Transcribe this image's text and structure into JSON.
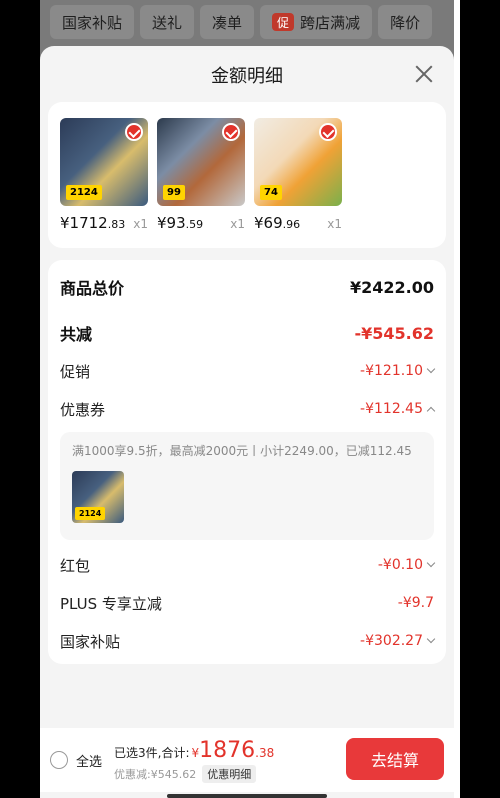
{
  "top_tabs": [
    {
      "label": "国家补贴"
    },
    {
      "label": "送礼"
    },
    {
      "label": "凑单"
    },
    {
      "label": "跨店满减",
      "icon": "promo-icon",
      "icon_text": "促"
    },
    {
      "label": "降价"
    }
  ],
  "sheet": {
    "title": "金额明细"
  },
  "products": [
    {
      "price_int": "¥1712",
      "price_dec": ".83",
      "qty": "x1",
      "tag": "2124"
    },
    {
      "price_int": "¥93",
      "price_dec": ".59",
      "qty": "x1",
      "tag": "99"
    },
    {
      "price_int": "¥69",
      "price_dec": ".96",
      "qty": "x1",
      "tag": "74"
    }
  ],
  "details": {
    "total_label": "商品总价",
    "total_value": "¥2422.00",
    "reduce_label": "共减",
    "reduce_value": "-¥545.62",
    "promo_label": "促销",
    "promo_value": "-¥121.10",
    "coupon_label": "优惠券",
    "coupon_value": "-¥112.45",
    "coupon_text": "满1000享9.5折，最高减2000元丨小计2249.00，已减112.45",
    "coupon_thumb_tag": "2124",
    "redpacket_label": "红包",
    "redpacket_value": "-¥0.10",
    "plus_label": "PLUS 专享立减",
    "plus_value": "-¥9.7",
    "subsidy_label": "国家补贴",
    "subsidy_value": "-¥302.27"
  },
  "bottom": {
    "select_all": "全选",
    "selected_summary": "已选3件,合计:",
    "total_symbol": "¥",
    "total_int": "1876",
    "total_dec": ".38",
    "discount_label": "优惠减:¥545.62",
    "detail_link": "优惠明细",
    "checkout": "去结算"
  },
  "colors": {
    "accent": "#e2332b",
    "checkout": "#e8393a"
  }
}
